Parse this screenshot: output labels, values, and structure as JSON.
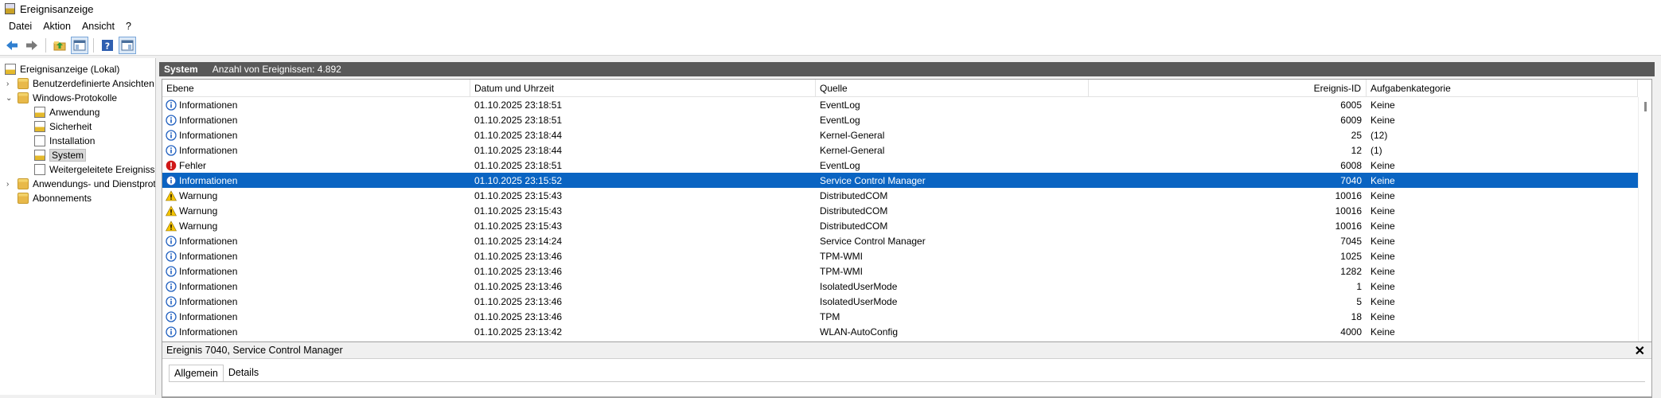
{
  "window": {
    "title": "Ereignisanzeige"
  },
  "menu": [
    "Datei",
    "Aktion",
    "Ansicht",
    "?"
  ],
  "toolbar": {
    "icons": [
      "back-arrow-icon",
      "forward-arrow-icon",
      "folder-up-icon",
      "show-hide-tree-icon",
      "help-icon",
      "show-hide-action-icon"
    ]
  },
  "tree": {
    "root": "Ereignisanzeige (Lokal)",
    "custom_views": "Benutzerdefinierte Ansichten",
    "windows_logs": "Windows-Protokolle",
    "logs": [
      "Anwendung",
      "Sicherheit",
      "Installation",
      "System",
      "Weitergeleitete Ereignisse"
    ],
    "selected_log": "System",
    "app_services": "Anwendungs- und Dienstprotokolle",
    "subscriptions": "Abonnements"
  },
  "header": {
    "log_name": "System",
    "count_text": "Anzahl von Ereignissen: 4.892"
  },
  "columns": {
    "level": "Ebene",
    "date": "Datum und Uhrzeit",
    "source": "Quelle",
    "id": "Ereignis-ID",
    "category": "Aufgabenkategorie"
  },
  "rows": [
    {
      "level": "Informationen",
      "kind": "info",
      "date": "01.10.2025 23:18:51",
      "source": "EventLog",
      "id": "6005",
      "category": "Keine"
    },
    {
      "level": "Informationen",
      "kind": "info",
      "date": "01.10.2025 23:18:51",
      "source": "EventLog",
      "id": "6009",
      "category": "Keine"
    },
    {
      "level": "Informationen",
      "kind": "info",
      "date": "01.10.2025 23:18:44",
      "source": "Kernel-General",
      "id": "25",
      "category": "(12)"
    },
    {
      "level": "Informationen",
      "kind": "info",
      "date": "01.10.2025 23:18:44",
      "source": "Kernel-General",
      "id": "12",
      "category": "(1)"
    },
    {
      "level": "Fehler",
      "kind": "error",
      "date": "01.10.2025 23:18:51",
      "source": "EventLog",
      "id": "6008",
      "category": "Keine"
    },
    {
      "level": "Informationen",
      "kind": "info",
      "date": "01.10.2025 23:15:52",
      "source": "Service Control Manager",
      "id": "7040",
      "category": "Keine",
      "selected": true
    },
    {
      "level": "Warnung",
      "kind": "warn",
      "date": "01.10.2025 23:15:43",
      "source": "DistributedCOM",
      "id": "10016",
      "category": "Keine"
    },
    {
      "level": "Warnung",
      "kind": "warn",
      "date": "01.10.2025 23:15:43",
      "source": "DistributedCOM",
      "id": "10016",
      "category": "Keine"
    },
    {
      "level": "Warnung",
      "kind": "warn",
      "date": "01.10.2025 23:15:43",
      "source": "DistributedCOM",
      "id": "10016",
      "category": "Keine"
    },
    {
      "level": "Informationen",
      "kind": "info",
      "date": "01.10.2025 23:14:24",
      "source": "Service Control Manager",
      "id": "7045",
      "category": "Keine"
    },
    {
      "level": "Informationen",
      "kind": "info",
      "date": "01.10.2025 23:13:46",
      "source": "TPM-WMI",
      "id": "1025",
      "category": "Keine"
    },
    {
      "level": "Informationen",
      "kind": "info",
      "date": "01.10.2025 23:13:46",
      "source": "TPM-WMI",
      "id": "1282",
      "category": "Keine"
    },
    {
      "level": "Informationen",
      "kind": "info",
      "date": "01.10.2025 23:13:46",
      "source": "IsolatedUserMode",
      "id": "1",
      "category": "Keine"
    },
    {
      "level": "Informationen",
      "kind": "info",
      "date": "01.10.2025 23:13:46",
      "source": "IsolatedUserMode",
      "id": "5",
      "category": "Keine"
    },
    {
      "level": "Informationen",
      "kind": "info",
      "date": "01.10.2025 23:13:46",
      "source": "TPM",
      "id": "18",
      "category": "Keine"
    },
    {
      "level": "Informationen",
      "kind": "info",
      "date": "01.10.2025 23:13:42",
      "source": "WLAN-AutoConfig",
      "id": "4000",
      "category": "Keine"
    }
  ],
  "detail": {
    "title": "Ereignis 7040, Service Control Manager",
    "close_glyph": "✕",
    "tabs": [
      "Allgemein",
      "Details"
    ],
    "active_tab": "Allgemein"
  },
  "colors": {
    "selection": "#0a64c2",
    "header_bar": "#595959",
    "info": "#1f5fbf",
    "error": "#d01818",
    "warning": "#f5c400"
  }
}
